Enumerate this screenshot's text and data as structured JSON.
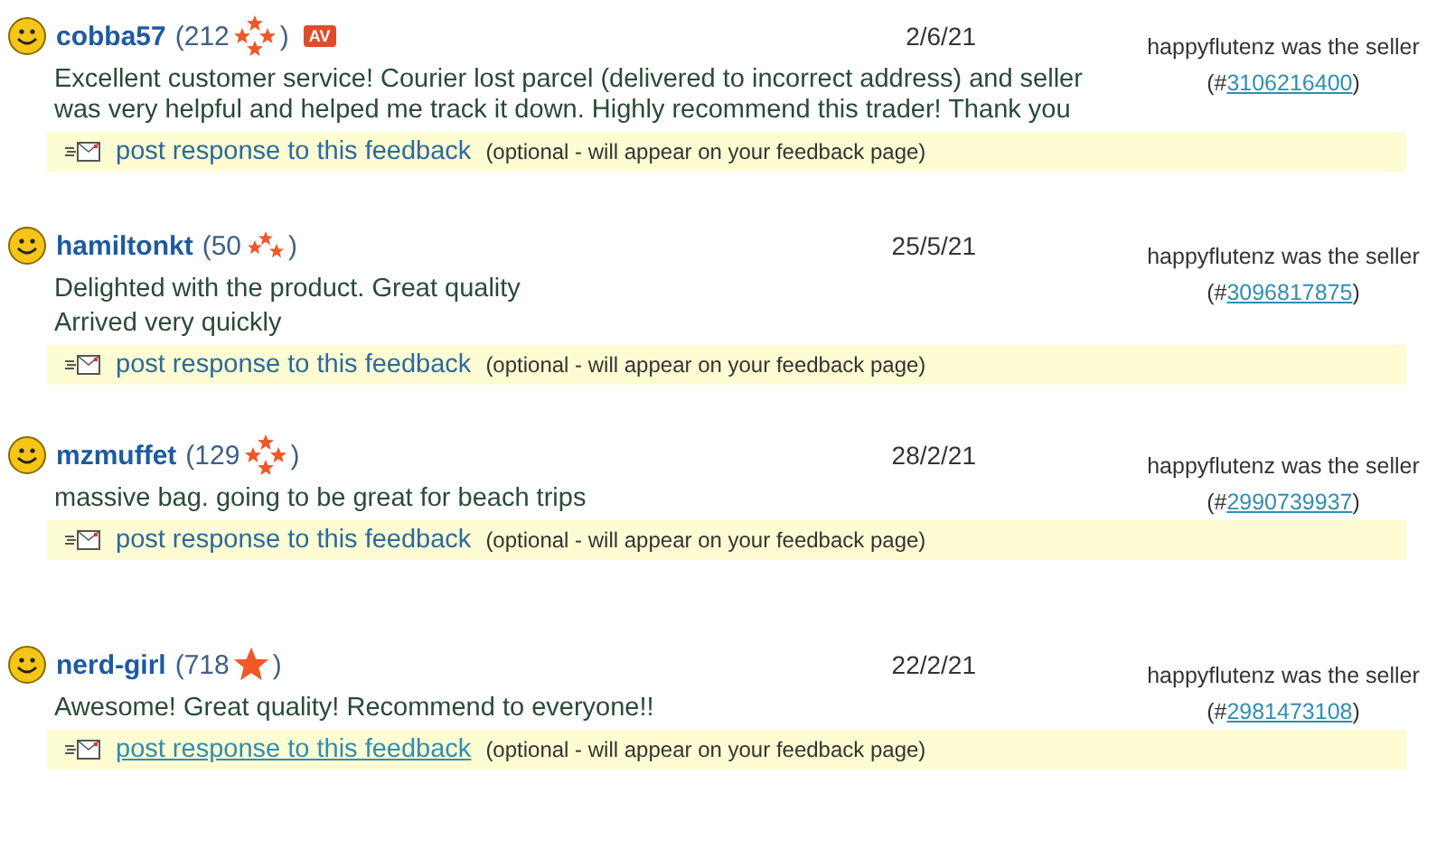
{
  "feedback": [
    {
      "user": "cobba57",
      "score": "(212",
      "score_end": ")",
      "kind": "ring",
      "av_badge": "AV",
      "date": "2/6/21",
      "comment": [
        "Excellent customer service! Courier lost parcel (delivered to incorrect address) and seller was very helpful and helped me track it down. Highly recommend this trader! Thank you"
      ],
      "seller_note": "happyflutenz was the seller",
      "order_prefix": "(#",
      "order_number": "3106216400",
      "order_suffix": ")",
      "response_link": "post response to this feedback",
      "response_note": "(optional - will appear on your feedback page)",
      "link_hovered": false
    },
    {
      "user": "hamiltonkt",
      "score": "(50",
      "score_end": ")",
      "kind": "triple",
      "date": "25/5/21",
      "comment": [
        "Delighted with the product. Great quality",
        "Arrived very quickly"
      ],
      "seller_note": "happyflutenz was the seller",
      "order_prefix": "(#",
      "order_number": "3096817875",
      "order_suffix": ")",
      "response_link": "post response to this feedback",
      "response_note": "(optional - will appear on your feedback page)",
      "link_hovered": false
    },
    {
      "user": "mzmuffet",
      "score": "(129",
      "score_end": ")",
      "kind": "ring",
      "date": "28/2/21",
      "comment": [
        "massive bag. going to be great for beach trips"
      ],
      "seller_note": "happyflutenz was the seller",
      "order_prefix": "(#",
      "order_number": "2990739937",
      "order_suffix": ")",
      "response_link": "post response to this feedback",
      "response_note": "(optional - will appear on your feedback page)",
      "link_hovered": false
    },
    {
      "user": "nerd-girl",
      "score": "(718",
      "score_end": ")",
      "kind": "single",
      "date": "22/2/21",
      "comment": [
        "Awesome! Great quality! Recommend to everyone!!"
      ],
      "seller_note": "happyflutenz was the seller",
      "order_prefix": "(#",
      "order_number": "2981473108",
      "order_suffix": ")",
      "response_link": "post response to this feedback",
      "response_note": "(optional - will appear on your feedback page)",
      "link_hovered": true
    }
  ]
}
